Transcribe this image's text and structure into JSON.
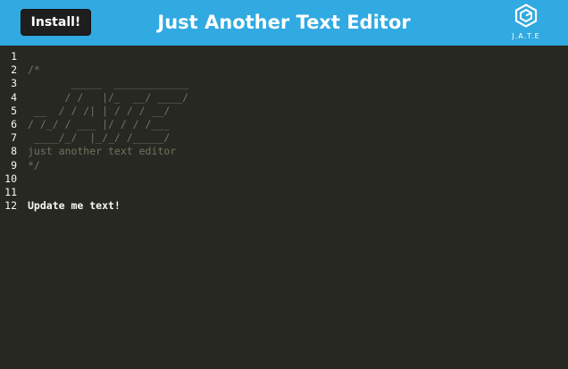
{
  "navbar": {
    "install_label": "Install!",
    "title": "Just Another Text Editor",
    "logo_text": "J.A.T.E",
    "logo_icon": "jate-hexagon-logo-icon",
    "background_color": "#31a9e1"
  },
  "editor": {
    "theme": "monokai",
    "lines": [
      {
        "number": "1",
        "text": "",
        "type": "comment"
      },
      {
        "number": "2",
        "text": "/*",
        "type": "comment"
      },
      {
        "number": "3",
        "text": "       _____  ____________",
        "type": "comment"
      },
      {
        "number": "4",
        "text": "      / /   |/_  __/ ____/",
        "type": "comment"
      },
      {
        "number": "5",
        "text": " __  / / /| | / / / __/",
        "type": "comment"
      },
      {
        "number": "6",
        "text": "/ /_/ / ___ |/ / / /___",
        "type": "comment"
      },
      {
        "number": "7",
        "text": " ____/_/  |_/_/ /_____/",
        "type": "comment"
      },
      {
        "number": "8",
        "text": "just another text editor",
        "type": "comment"
      },
      {
        "number": "9",
        "text": "*/",
        "type": "comment"
      },
      {
        "number": "10",
        "text": "",
        "type": "comment"
      },
      {
        "number": "11",
        "text": "",
        "type": "comment"
      },
      {
        "number": "12",
        "text": "Update me text!",
        "type": "plain"
      }
    ]
  }
}
